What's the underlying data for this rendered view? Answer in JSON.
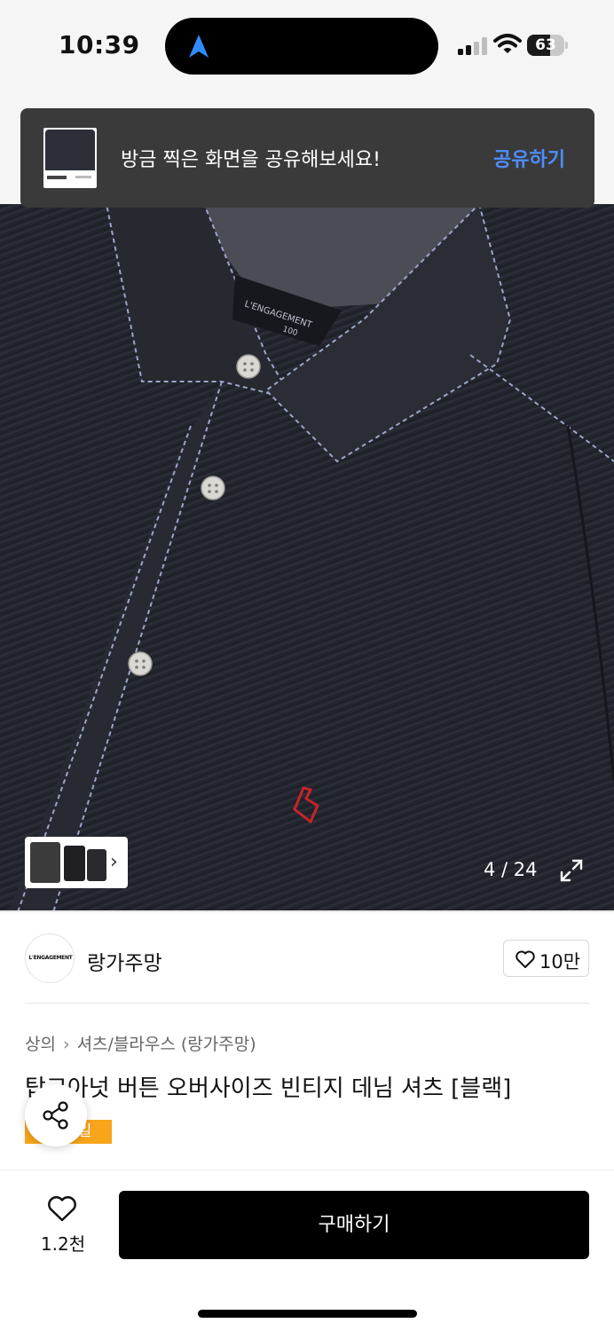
{
  "status_bar": {
    "time": "10:39",
    "battery_percent": "63",
    "battery_level": 0.63,
    "icons": [
      "navigation-arrow-icon",
      "cellular-signal-icon",
      "wifi-icon",
      "battery-icon"
    ]
  },
  "toast": {
    "message": "방금 찍은 화면을 공유해보세요!",
    "action_label": "공유하기"
  },
  "gallery": {
    "page_counter": "4 / 24",
    "brand_tag_text": "L'ENGAGEMENT",
    "tag_size": "100"
  },
  "brand": {
    "logo_text": "L'ENGAGEMENT",
    "name": "랑가주망",
    "like_count": "10만"
  },
  "product": {
    "breadcrumb": [
      "상의",
      "셔츠/블라우스 (랑가주망)"
    ],
    "title": "탑고아넛 버튼 오버사이즈 빈티지 데님 셔츠 [블랙]",
    "sale_badge": "세일"
  },
  "bottom_bar": {
    "wish_count": "1.2천",
    "buy_label": "구매하기"
  },
  "colors": {
    "accent_blue": "#4d8dff",
    "sale_orange": "#f8a51b",
    "denim": "#1e2129",
    "buy_button": "#000000"
  }
}
